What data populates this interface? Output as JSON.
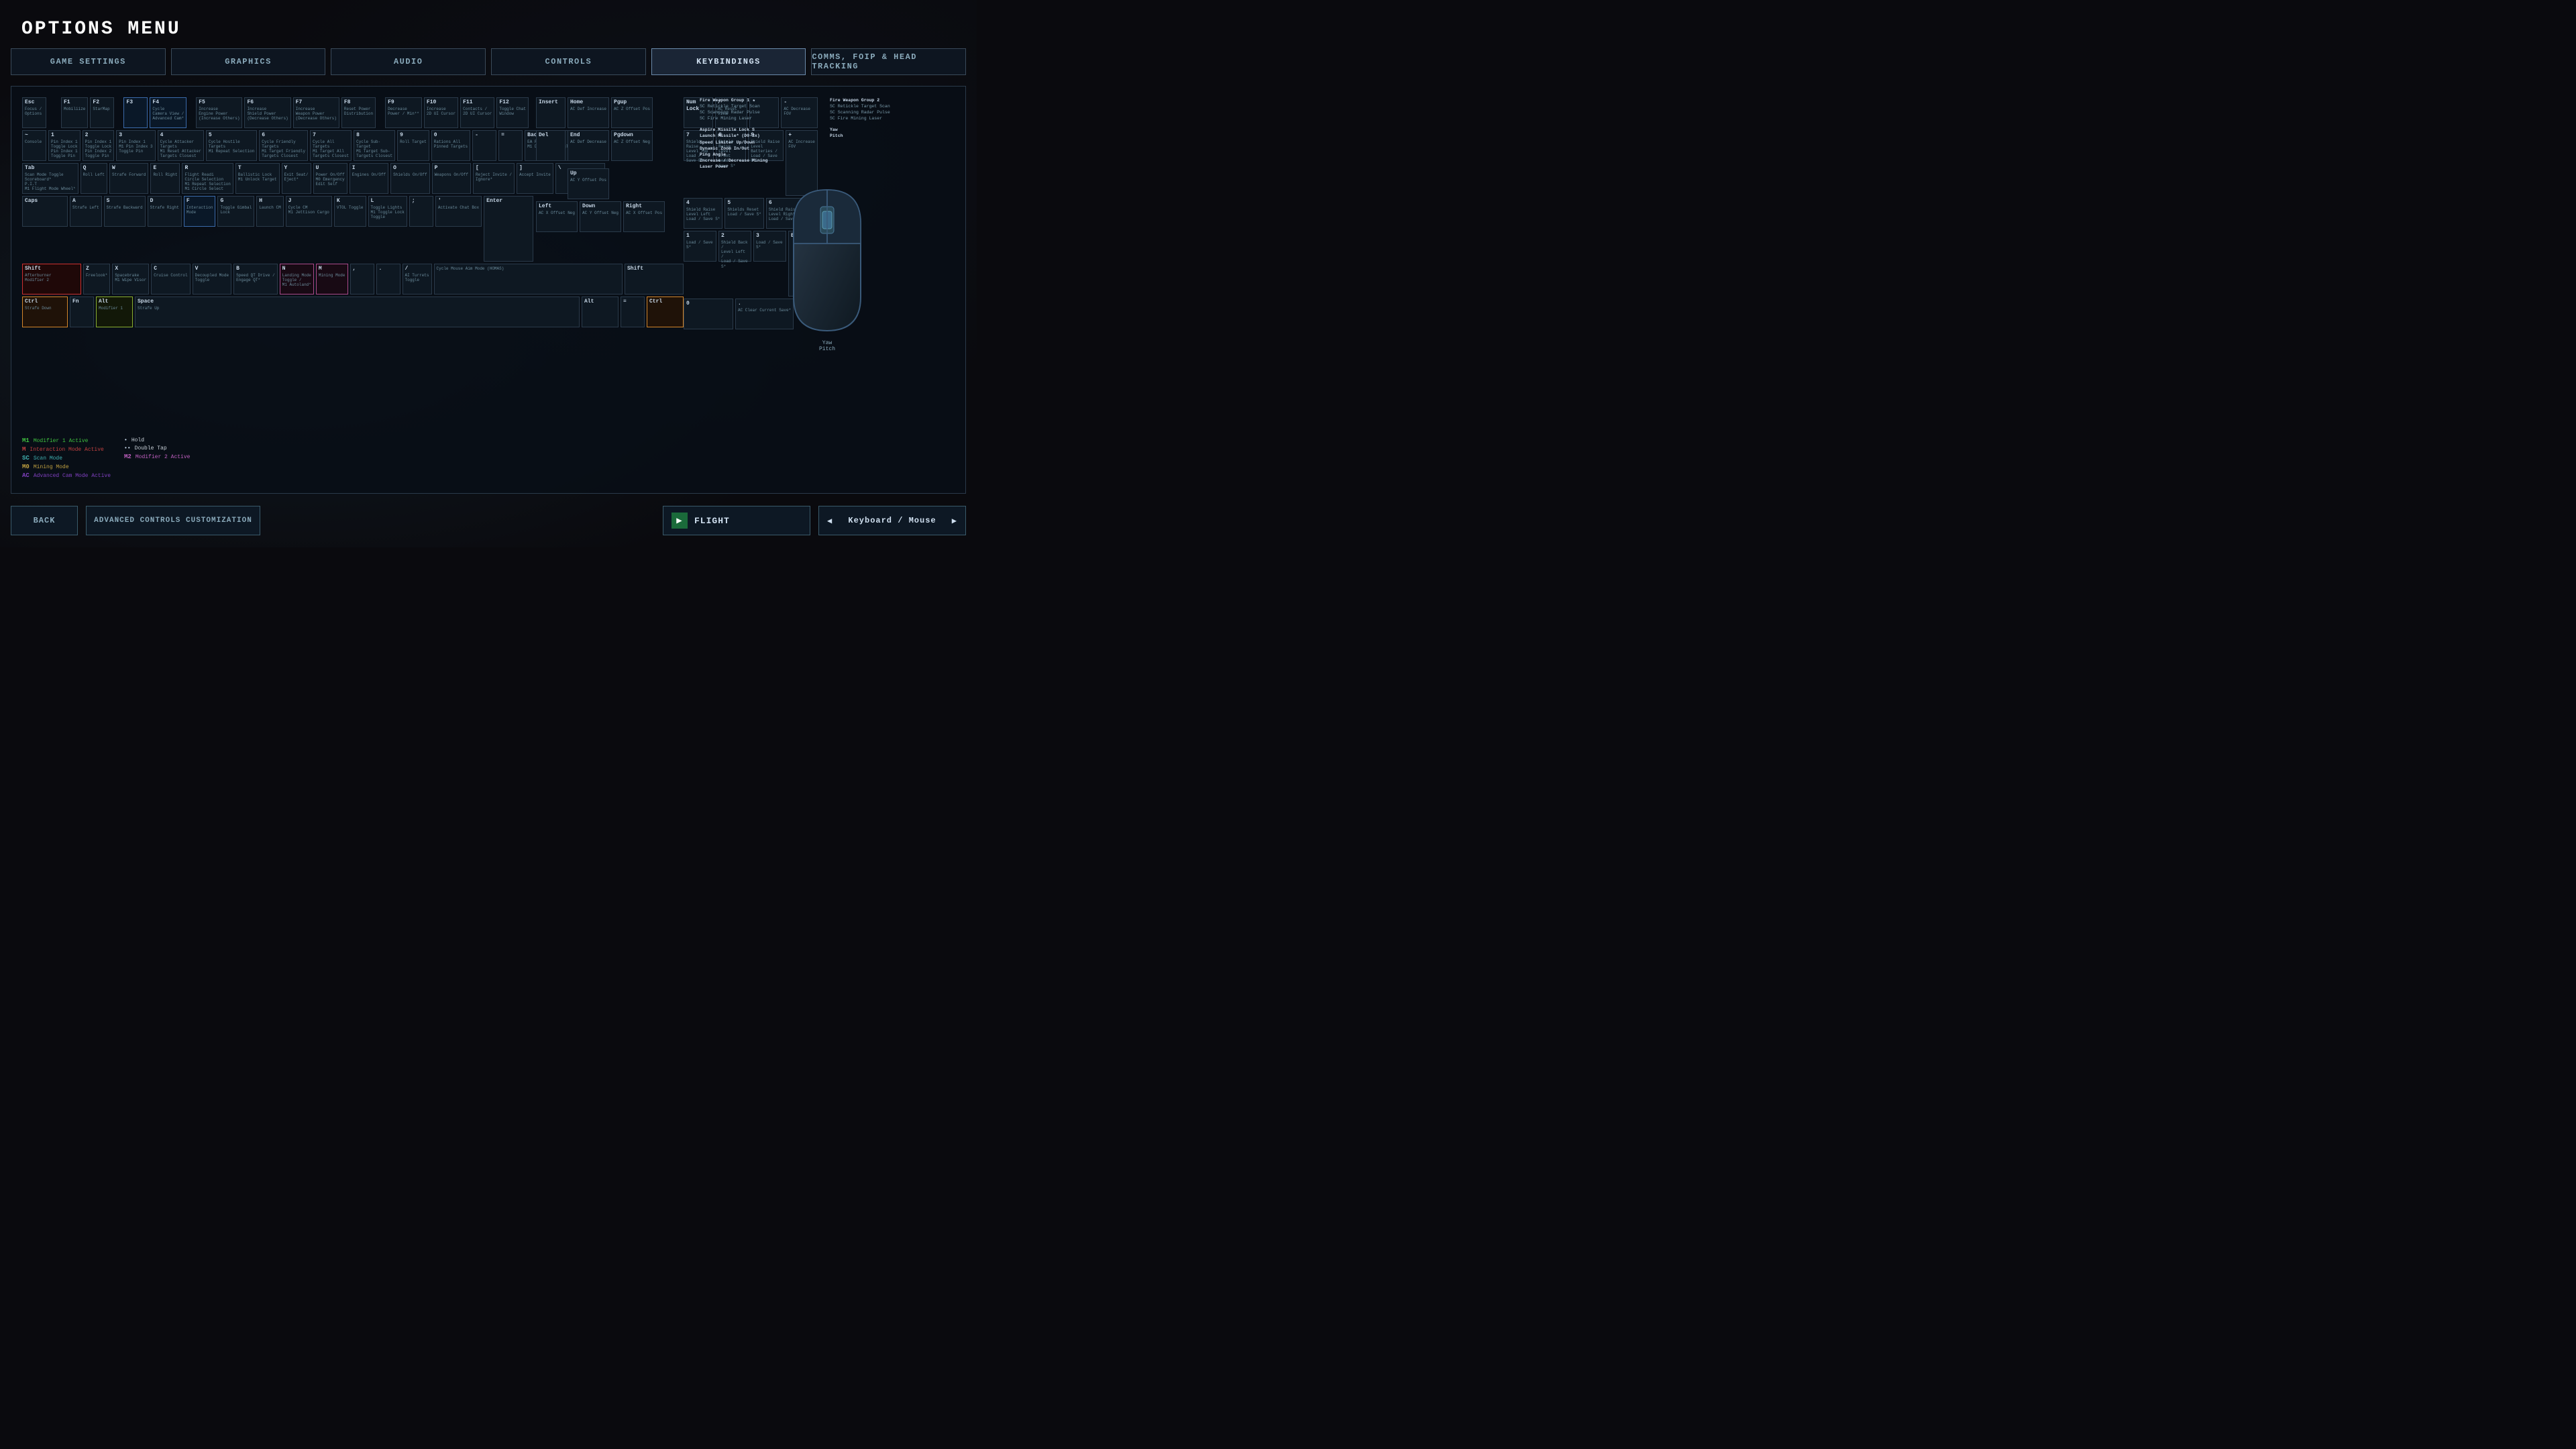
{
  "page": {
    "title": "OPTIONS MENU"
  },
  "nav": {
    "tabs": [
      {
        "id": "game-settings",
        "label": "GAME SETTINGS",
        "active": false
      },
      {
        "id": "graphics",
        "label": "GRAPHICS",
        "active": false
      },
      {
        "id": "audio",
        "label": "AUDIO",
        "active": false
      },
      {
        "id": "controls",
        "label": "CONTROLS",
        "active": false
      },
      {
        "id": "keybindings",
        "label": "KEYBINDINGS",
        "active": true
      },
      {
        "id": "comms",
        "label": "COMMS, FOIP & HEAD TRACKING",
        "active": false
      }
    ]
  },
  "buttons": {
    "back": "BACK",
    "advanced": "ADVANCED CONTROLS CUSTOMIZATION",
    "flight": "FLIGHT",
    "keyboard_mouse": "Keyboard / Mouse"
  },
  "legend": {
    "items": [
      {
        "code": "M1",
        "label": "Modifier 1 Active",
        "color": "#40c040"
      },
      {
        "code": "M",
        "label": "Interaction Mode Active",
        "color": "#c04040"
      },
      {
        "code": "SC",
        "label": "Scan Mode",
        "color": "#40b0b0"
      },
      {
        "code": "M0",
        "label": "Mining Mode",
        "color": "#c0a040"
      },
      {
        "code": "AC",
        "label": "Advanced Cam Mode Active",
        "color": "#8040c0"
      }
    ],
    "symbols": [
      {
        "sym": "•",
        "label": "Hold"
      },
      {
        "sym": "••",
        "label": "Double Tap"
      },
      {
        "sym": "M2",
        "label": "Modifier 2 Active",
        "color": "#c060c0"
      }
    ]
  }
}
